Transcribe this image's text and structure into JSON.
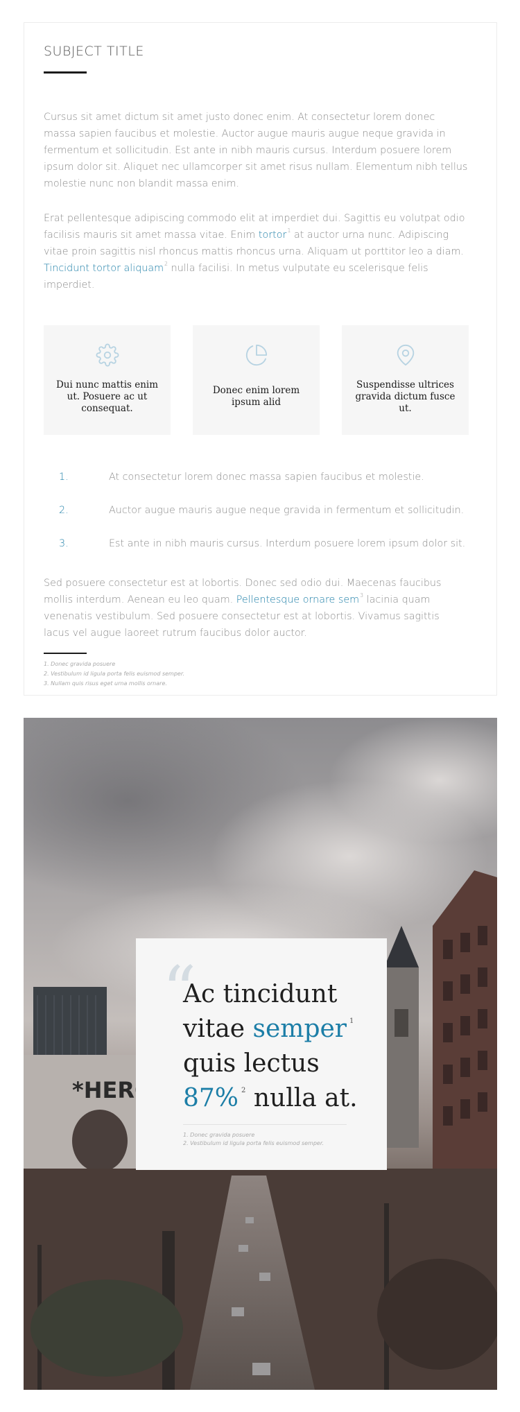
{
  "card": {
    "title": "SUBJECT TITLE",
    "paragraph1": "Cursus sit amet dictum sit amet justo donec enim. At consectetur lorem donec massa sapien faucibus et molestie. Auctor augue mauris augue neque gravida in fermentum et sollicitudin. Est ante in nibh mauris cursus. Interdum posuere lorem ipsum dolor sit. Aliquet nec ullamcorper sit amet risus nullam. Elementum nibh tellus molestie nunc non blandit massa enim.",
    "paragraph2": {
      "text_a": "Erat pellentesque adipiscing commodo elit at imperdiet dui. Sagittis eu volutpat odio facilisis mauris sit amet massa vitae. Enim ",
      "link_a": "tortor",
      "sup_a": "1",
      "text_b": " at auctor urna nunc. Adipiscing vitae proin sagittis nisl rhoncus mattis rhoncus urna. Aliquam ut porttitor leo a diam. ",
      "link_b": "Tincidunt tortor aliquam",
      "sup_b": "2",
      "text_c": " nulla facilisi. In metus vulputate eu scelerisque felis imperdiet."
    },
    "features": [
      {
        "icon": "gear-icon",
        "text": "Dui nunc mattis enim ut. Posuere ac ut consequat."
      },
      {
        "icon": "pie-chart-icon",
        "text": "Donec enim lorem ipsum alid"
      },
      {
        "icon": "map-pin-icon",
        "text": "Suspendisse ultrices gravida dictum fusce ut."
      }
    ],
    "list": [
      {
        "num": "1.",
        "text": "At consectetur lorem donec massa sapien faucibus et molestie."
      },
      {
        "num": "2.",
        "text": "Auctor augue mauris augue neque gravida in fermentum et sollicitudin."
      },
      {
        "num": "3.",
        "text": "Est ante in nibh mauris cursus. Interdum posuere lorem ipsum dolor sit."
      }
    ],
    "paragraph3": {
      "text_a": "Sed posuere consectetur est at lobortis. Donec sed odio dui. Maecenas faucibus mollis interdum. Aenean eu leo quam. ",
      "link_a": "Pellentesque ornare sem",
      "sup_a": "3",
      "text_b": " lacinia quam venenatis vestibulum. Sed posuere consectetur est at lobortis. Vivamus sagittis lacus vel augue laoreet rutrum faucibus dolor auctor."
    },
    "footnotes": [
      "1. Donec gravida posuere",
      "2. Vestibulum id ligula porta felis euismod semper.",
      "3. Nullam quis risus eget urna mollis ornare."
    ]
  },
  "quote": {
    "mark": "“",
    "line1": "Ac tincidunt",
    "line2_a": "vitae ",
    "line2_hl": "semper",
    "line2_sup": "1",
    "line3": "quis lectus",
    "line4_hl": "87%",
    "line4_sup": "2",
    "line4_b": " nulla at.",
    "footnotes": [
      "1. Donec gravida posuere",
      "2. Vestibulum id ligula porta felis euismod semper."
    ]
  },
  "photo": {
    "sign_text": "*HERO"
  },
  "colors": {
    "accent": "#1c7ea7",
    "body_text": "#8c8c8c",
    "heading": "#1f1f1f",
    "feature_bg": "#f6f6f6"
  }
}
